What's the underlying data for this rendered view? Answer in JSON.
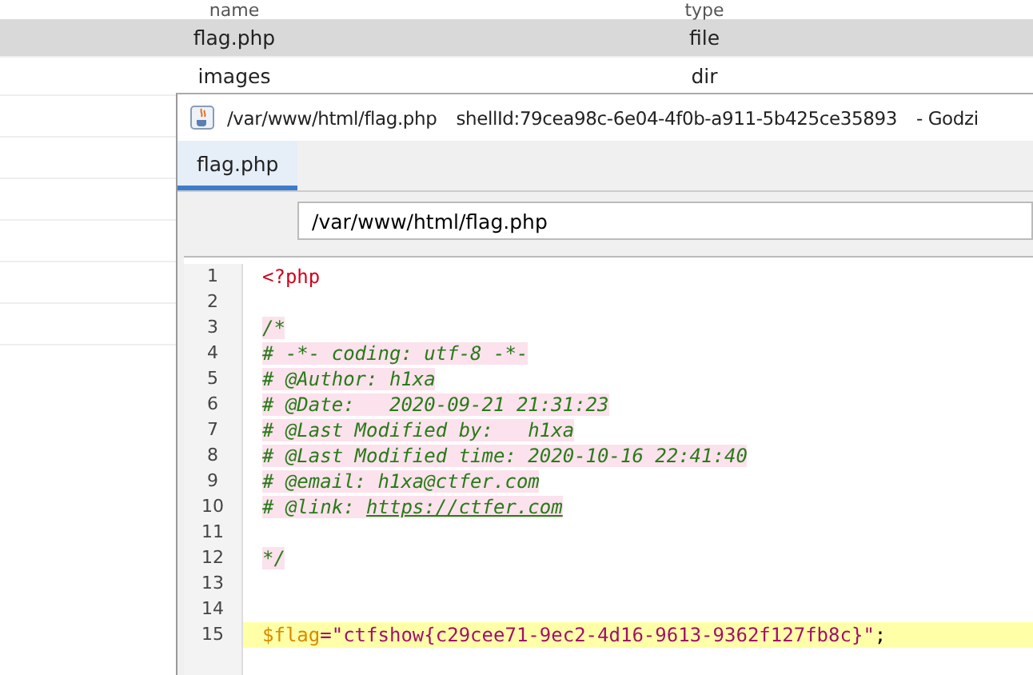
{
  "file_table": {
    "columns": [
      "name",
      "type"
    ],
    "rows": [
      {
        "name": "flag.php",
        "type": "file",
        "selected": true
      },
      {
        "name": "images",
        "type": "dir",
        "selected": false
      }
    ]
  },
  "editor_window": {
    "title": "/var/www/html/flag.php",
    "shell_id": "shellId:79cea98c-6e04-4f0b-a911-5b425ce35893",
    "app_name": "- Godzi",
    "tabs": [
      {
        "label": "flag.php",
        "selected": true
      }
    ],
    "path_field": {
      "value": "/var/www/html/flag.php"
    },
    "lines": [
      {
        "number": "1",
        "current": false,
        "tokens": [
          {
            "kind": "tag",
            "text": "<?php"
          }
        ]
      },
      {
        "number": "2",
        "current": false
      },
      {
        "number": "3",
        "current": false,
        "tokens": [
          {
            "kind": "comment",
            "text": "/*"
          }
        ]
      },
      {
        "number": "4",
        "current": false,
        "tokens": [
          {
            "kind": "comment",
            "text": "# -*- coding: utf-8 -*-"
          }
        ]
      },
      {
        "number": "5",
        "current": false,
        "tokens": [
          {
            "kind": "comment",
            "text": "# @Author: h1xa"
          }
        ]
      },
      {
        "number": "6",
        "current": false,
        "tokens": [
          {
            "kind": "comment",
            "text": "# @Date:   2020-09-21 21:31:23"
          }
        ]
      },
      {
        "number": "7",
        "current": false,
        "tokens": [
          {
            "kind": "comment",
            "text": "# @Last Modified by:   h1xa"
          }
        ]
      },
      {
        "number": "8",
        "current": false,
        "tokens": [
          {
            "kind": "comment",
            "text": "# @Last Modified time: 2020-10-16 22:41:40"
          }
        ]
      },
      {
        "number": "9",
        "current": false,
        "tokens": [
          {
            "kind": "comment",
            "text": "# @email: h1xa@ctfer.com"
          }
        ]
      },
      {
        "number": "10",
        "current": false,
        "tokens": [
          {
            "kind": "comment",
            "text": "# @link: "
          },
          {
            "kind": "link",
            "text": "https://ctfer.com"
          }
        ]
      },
      {
        "number": "11",
        "current": false
      },
      {
        "number": "12",
        "current": false,
        "tokens": [
          {
            "kind": "comment",
            "text": "*/"
          }
        ]
      },
      {
        "number": "13",
        "current": false
      },
      {
        "number": "14",
        "current": false
      },
      {
        "number": "15",
        "current": true,
        "tokens": [
          {
            "kind": "variable",
            "text": "$flag"
          },
          {
            "kind": "operator",
            "text": "="
          },
          {
            "kind": "string",
            "text": "\"ctfshow{c29cee71-9ec2-4d16-9613-9362f127fb8c}\""
          },
          {
            "kind": "plain",
            "text": ";"
          }
        ]
      }
    ]
  }
}
